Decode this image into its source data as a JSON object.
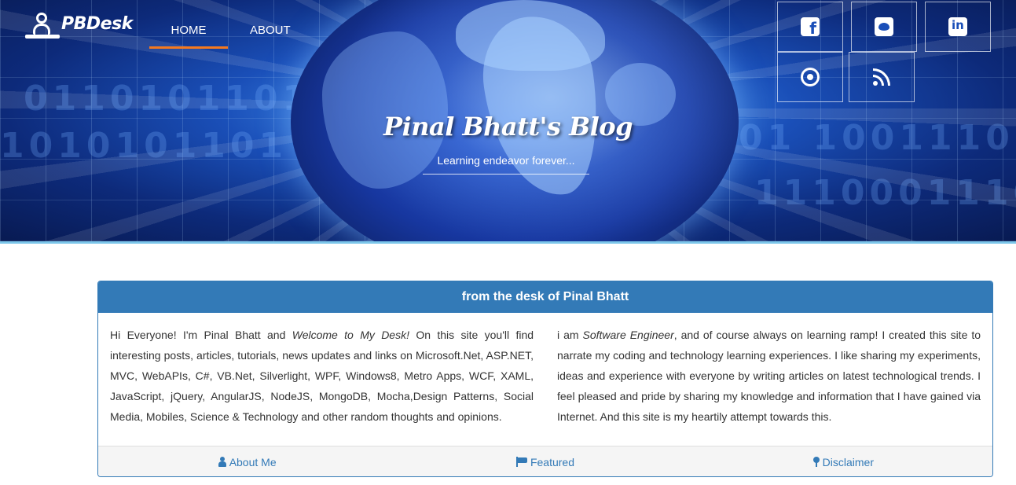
{
  "nav": {
    "logo_text": "PBDesk",
    "home_label": "HOME",
    "about_label": "ABOUT"
  },
  "social": [
    "facebook-icon",
    "twitter-icon",
    "linkedin-icon",
    "github-icon",
    "rss-icon"
  ],
  "hero": {
    "title": "Pinal Bhatt's Blog",
    "tagline": "Learning endeavor forever..."
  },
  "panel": {
    "heading": "from the desk of Pinal Bhatt",
    "left_parts": {
      "a": "Hi Everyone! I'm Pinal Bhatt and ",
      "em": "Welcome to My Desk!",
      "b": " On this site you'll find interesting posts, articles, tutorials, news updates and links on Microsoft.Net, ASP.NET, MVC, WebAPIs, C#, VB.Net, Silverlight, WPF, Windows8, Metro Apps, WCF, XAML, JavaScript, jQuery, AngularJS, NodeJS, MongoDB, Mocha,Design Patterns, Social Media, Mobiles, Science & Technology and other random thoughts and opinions."
    },
    "right_parts": {
      "a": "i am ",
      "em": "Software Engineer",
      "b": ", and of course always on learning ramp! I created this site to narrate my coding and technology learning experiences. I like sharing my experiments, ideas and experience with everyone by writing articles on latest technological trends. I feel pleased and pride by sharing my knowledge and information that I have gained via Internet. And this site is my heartily attempt towards this."
    },
    "footer": {
      "about_me": "About Me",
      "featured": "Featured",
      "disclaimer": "Disclaimer"
    }
  },
  "colors": {
    "accent_orange": "#f4791f",
    "panel_blue": "#337ab7",
    "hero_blue": "#1a4fb8"
  }
}
